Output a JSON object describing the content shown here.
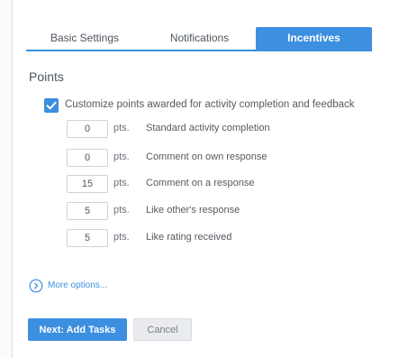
{
  "tabs": [
    {
      "label": "Basic Settings",
      "active": false
    },
    {
      "label": "Notifications",
      "active": false
    },
    {
      "label": "Incentives",
      "active": true
    }
  ],
  "section": {
    "title": "Points"
  },
  "customize": {
    "checked": true,
    "label": "Customize points awarded for activity completion and feedback"
  },
  "rows": [
    {
      "value": "0",
      "unit": "pts.",
      "label": "Standard activity completion"
    },
    {
      "value": "0",
      "unit": "pts.",
      "label": "Comment on own response"
    },
    {
      "value": "15",
      "unit": "pts.",
      "label": "Comment on a response"
    },
    {
      "value": "5",
      "unit": "pts.",
      "label": "Like other's response"
    },
    {
      "value": "5",
      "unit": "pts.",
      "label": "Like rating received"
    }
  ],
  "more_options": {
    "label": "More options...",
    "icon": "chevron-right-circle-icon"
  },
  "buttons": {
    "next_label": "Next: Add Tasks",
    "cancel_label": "Cancel"
  },
  "colors": {
    "accent": "#3d8fe0",
    "text": "#555a60",
    "border": "#cfd4d9",
    "cancel_bg": "#e9ebee"
  }
}
